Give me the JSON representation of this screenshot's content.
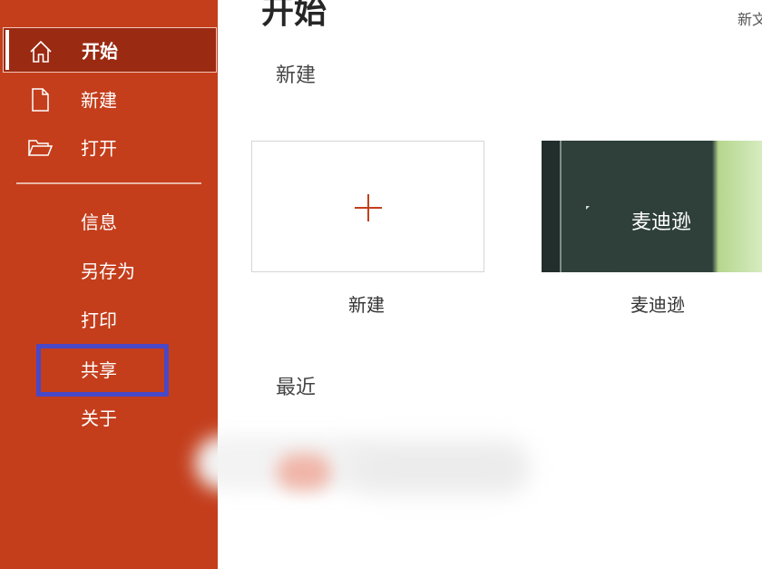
{
  "sidebar": {
    "nav": [
      {
        "label": "开始",
        "icon": "home-icon",
        "active": true
      },
      {
        "label": "新建",
        "icon": "new-document-icon",
        "active": false
      },
      {
        "label": "打开",
        "icon": "open-folder-icon",
        "active": false
      }
    ],
    "items": [
      {
        "label": "信息"
      },
      {
        "label": "另存为"
      },
      {
        "label": "打印"
      },
      {
        "label": "共享"
      },
      {
        "label": "关于"
      }
    ]
  },
  "main": {
    "title": "开始",
    "top_right_link": "新文",
    "new_section_label": "新建",
    "recent_section_label": "最近",
    "tiles": [
      {
        "caption": "新建",
        "icon": "plus-icon"
      },
      {
        "caption": "麦迪逊",
        "thumbnail_text": "麦迪逊"
      }
    ]
  },
  "colors": {
    "sidebar": "#c43e1c",
    "sidebar_active": "#9b2a12",
    "highlight_box": "#4848c8",
    "plus": "#c43e1c"
  }
}
